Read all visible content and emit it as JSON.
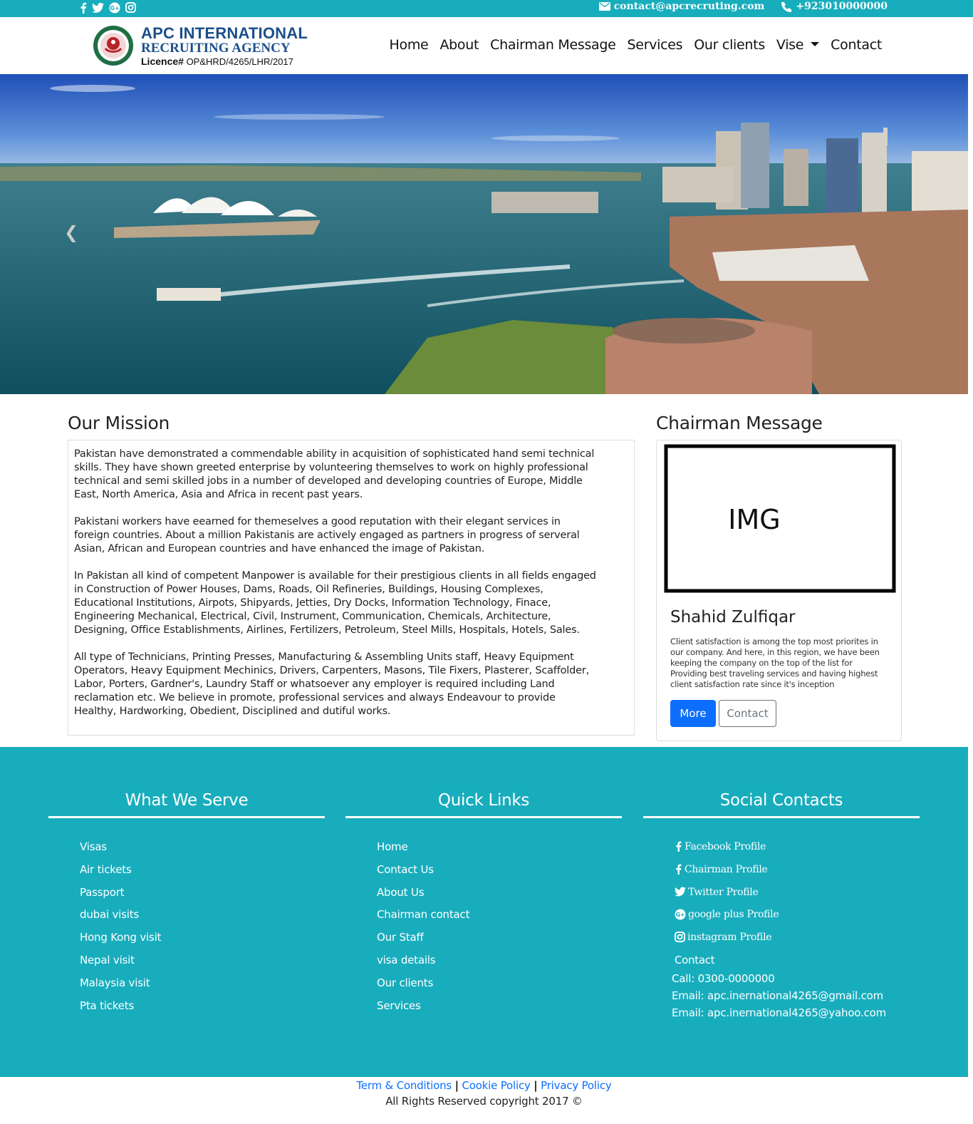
{
  "topbar": {
    "social_icons": [
      "facebook-icon",
      "twitter-icon",
      "google-plus-icon",
      "instagram-icon"
    ],
    "email": "contact@apcrecruting.com",
    "phone": "+923010000000"
  },
  "logo": {
    "line1": "APC INTERNATIONAL",
    "line2": "RECRUITING AGENCY",
    "licence_label": "Licence#",
    "licence_number": "OP&HRD/4265/LHR/2017"
  },
  "nav": {
    "items": [
      "Home",
      "About",
      "Chairman Message",
      "Services",
      "Our clients",
      "Vise",
      "Contact"
    ]
  },
  "hero": {
    "prev_icon": "chevron-left-icon"
  },
  "mission": {
    "title": "Our Mission",
    "paragraphs": [
      "Pakistan have demonstrated a commendable ability in acquisition of sophisticated hand semi technical skills. They have shown greeted enterprise by volunteering themselves to work on highly professional technical and semi skilled jobs in a number of developed and developing countries of Europe, Middle East, North America, Asia and Africa in recent past years.",
      "Pakistani workers have eearned for themeselves a good reputation with their elegant services in foreign countries. About a million Pakistanis are actively engaged as partners in progress of serveral Asian, African and European countries and have enhanced the image of Pakistan.",
      "In Pakistan all kind of competent Manpower is available for their prestigious clients in all fields engaged in Construction of Power Houses, Dams, Roads, Oil Refineries, Buildings, Housing Complexes, Educational Institutions, Airpots, Shipyards, Jetties, Dry Docks, Information Technology, Finace, Engineering Mechanical, Electrical, Civil, Instrument, Communication, Chemicals, Architecture, Designing, Office Establishments, Airlines, Fertilizers, Petroleum, Steel Mills, Hospitals, Hotels, Sales.",
      "All type of Technicians, Printing Presses, Manufacturing & Assembling Units staff, Heavy Equipment Operators, Heavy Equipment Mechinics, Drivers, Carpenters, Masons, Tile Fixers, Plasterer, Scaffolder, Labor, Porters, Gardner's, Laundry Staff or whatsoever any employer is required including Land reclamation etc. We believe in promote, professional services and always Endeavour to provide Healthy, Hardworking, Obedient, Disciplined and dutiful works."
    ]
  },
  "chairman": {
    "title": "Chairman Message",
    "img_text": "IMG",
    "name": "Shahid Zulfiqar",
    "text": "Client satisfaction is among the top most priorites in our company. And here, in this region, we have been keeping the company on the top of the list for Providing best traveling services and having highest client satisfaction rate since it's inception",
    "more_label": "More",
    "contact_label": "Contact"
  },
  "footer": {
    "serve": {
      "title": "What We Serve",
      "items": [
        "Visas",
        "Air tickets",
        "Passport",
        "dubai visits",
        "Hong Kong visit",
        "Nepal visit",
        "Malaysia visit",
        "Pta tickets"
      ]
    },
    "quick": {
      "title": "Quick Links",
      "items": [
        "Home",
        "Contact Us",
        "About Us",
        "Chairman contact",
        "Our Staff",
        "visa details",
        "Our clients",
        "Services"
      ]
    },
    "social": {
      "title": "Social Contacts",
      "items": [
        {
          "icon": "facebook-icon",
          "label": "Facebook Profile"
        },
        {
          "icon": "facebook-icon",
          "label": "Chairman Profile"
        },
        {
          "icon": "twitter-icon",
          "label": "Twitter Profile"
        },
        {
          "icon": "google-plus-icon",
          "label": "google plus Profile"
        },
        {
          "icon": "instagram-icon",
          "label": "instagram Profile"
        }
      ],
      "contact_label": "Contact",
      "call": "Call: 0300-0000000",
      "email1": "Email: apc.inernational4265@gmail.com",
      "email2": "Email: apc.inernational4265@yahoo.com"
    }
  },
  "bottom": {
    "terms": "Term & Conditions",
    "cookie": "Cookie Policy",
    "privacy": "Privacy Policy",
    "separator": "|",
    "copyright": "All Rights Reserved copyright 2017 ©"
  },
  "colors": {
    "teal": "#18adbd",
    "primary": "#0d6efd",
    "logo_blue": "#1c4f8a"
  }
}
